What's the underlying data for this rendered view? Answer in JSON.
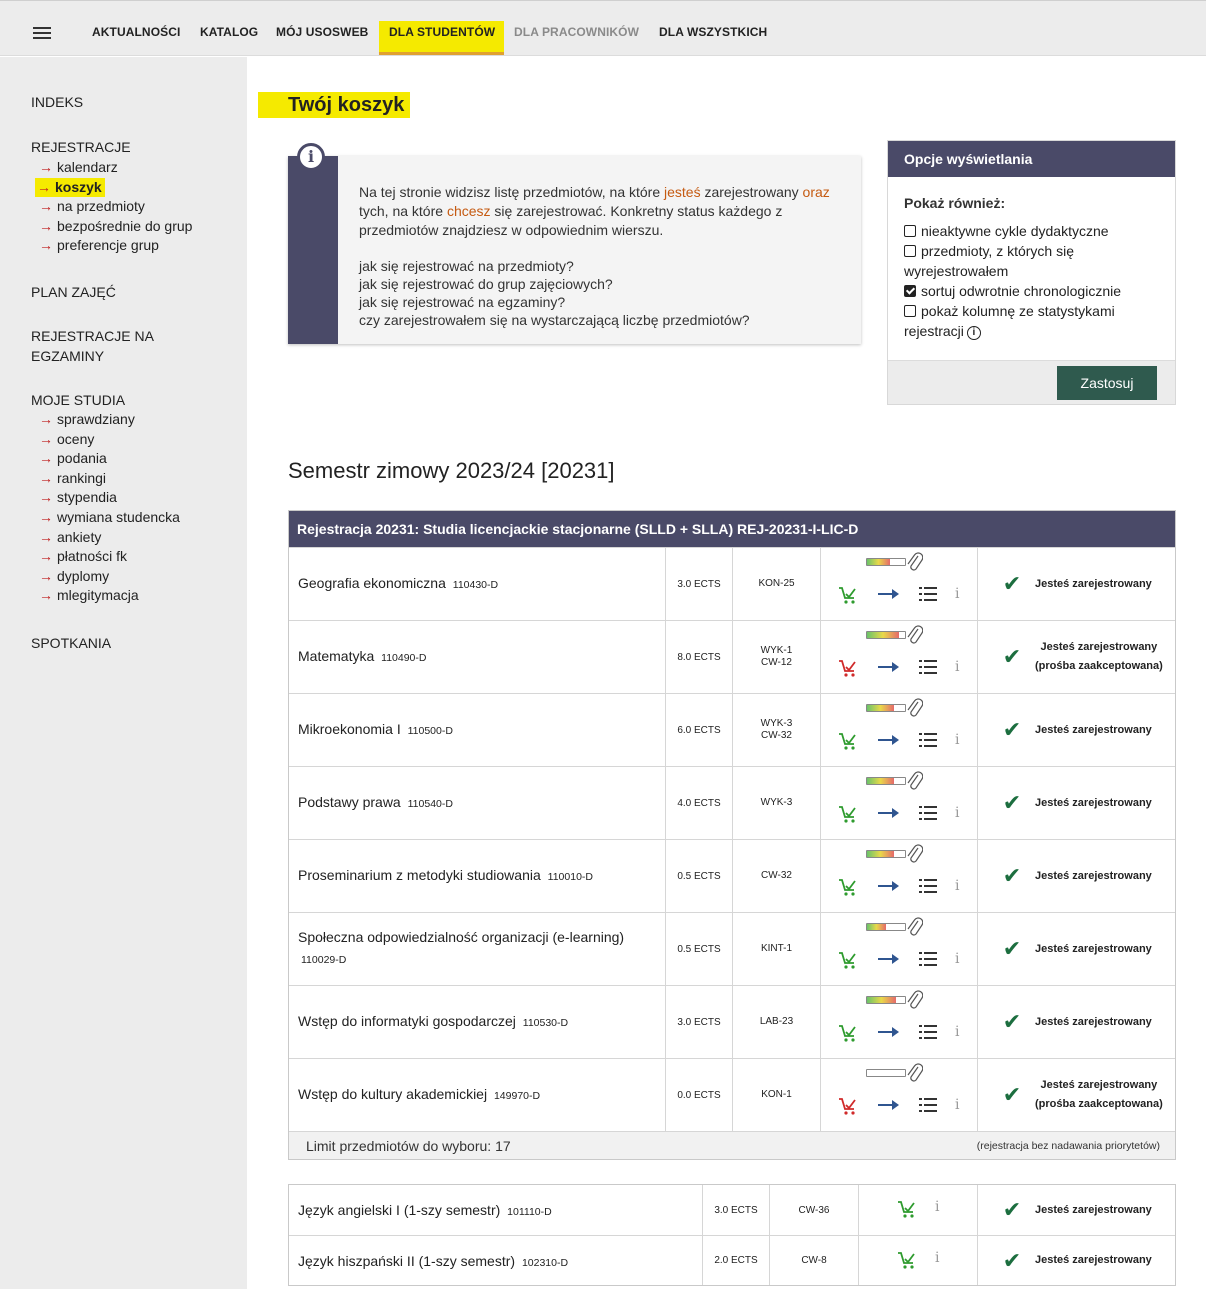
{
  "nav": {
    "items": [
      "AKTUALNOŚCI",
      "KATALOG",
      "MÓJ USOSWEB",
      "DLA STUDENTÓW",
      "DLA PRACOWNIKÓW",
      "DLA WSZYSTKICH"
    ],
    "active": "DLA STUDENTÓW"
  },
  "sidebar": {
    "indeks": "INDEKS",
    "rejestracje": "REJESTRACJE",
    "rej_items": [
      "kalendarz",
      "koszyk",
      "na przedmioty",
      "bezpośrednie do grup",
      "preferencje grup"
    ],
    "plan": "PLAN ZAJĘĆ",
    "rej_egz_1": "REJESTRACJE NA",
    "rej_egz_2": "EGZAMINY",
    "studia": "MOJE STUDIA",
    "studia_items": [
      "sprawdziany",
      "oceny",
      "podania",
      "rankingi",
      "stypendia",
      "wymiana studencka",
      "ankiety",
      "płatności fk",
      "dyplomy",
      "mlegitymacja"
    ],
    "spotkania": "SPOTKANIA"
  },
  "page_title": "Twój koszyk",
  "info": {
    "t1": "Na tej stronie widzisz listę przedmiotów, na które ",
    "t2": "jesteś",
    "t3": " zarejestrowany ",
    "t4": "oraz",
    "t5": " tych, na które ",
    "t6": "chcesz",
    "t7": " się zarejestrować. Konkretny status każdego z przedmiotów znajdziesz w odpowiednim wierszu.",
    "links": [
      "jak się rejestrować na przedmioty?",
      "jak się rejestrować do grup zajęciowych?",
      "jak się rejestrować na egzaminy?",
      "czy zarejestrowałem się na wystarczającą liczbę przedmiotów?"
    ]
  },
  "options": {
    "title": "Opcje wyświetlania",
    "subtitle": "Pokaż również:",
    "items": [
      {
        "label": "nieaktywne cykle dydaktyczne",
        "checked": false
      },
      {
        "label": "przedmioty, z których się wyrejestrowałem",
        "checked": false
      },
      {
        "label": "sortuj odwrotnie chronologicznie",
        "checked": true
      },
      {
        "label": "pokaż kolumnę ze statystykami rejestracji",
        "checked": false
      }
    ],
    "apply": "Zastosuj"
  },
  "semester": "Semestr zimowy 2023/24 [20231]",
  "registration": {
    "header": "Rejestracja 20231: Studia licencjackie stacjonarne (SLLD + SLLA) REJ-20231-I-LIC-D",
    "rows": [
      {
        "name": "Geografia ekonomiczna",
        "code": "110430-D",
        "ects": "3.0 ECTS",
        "groups": "KON-25",
        "fill": 0.6,
        "cart_color": "#2e9b2e",
        "status": "Jesteś zarejestrowany",
        "status2": ""
      },
      {
        "name": "Matematyka",
        "code": "110490-D",
        "ects": "8.0 ECTS",
        "groups": "WYK-1\nCW-12",
        "fill": 0.85,
        "cart_color": "#d02a2a",
        "status": "Jesteś zarejestrowany",
        "status2": "(prośba zaakceptowana)"
      },
      {
        "name": "Mikroekonomia I",
        "code": "110500-D",
        "ects": "6.0 ECTS",
        "groups": "WYK-3\nCW-32",
        "fill": 0.7,
        "cart_color": "#2e9b2e",
        "status": "Jesteś zarejestrowany",
        "status2": ""
      },
      {
        "name": "Podstawy prawa",
        "code": "110540-D",
        "ects": "4.0 ECTS",
        "groups": "WYK-3",
        "fill": 0.7,
        "cart_color": "#2e9b2e",
        "status": "Jesteś zarejestrowany",
        "status2": ""
      },
      {
        "name": "Proseminarium z metodyki studiowania",
        "code": "110010-D",
        "ects": "0.5 ECTS",
        "groups": "CW-32",
        "fill": 0.7,
        "cart_color": "#2e9b2e",
        "status": "Jesteś zarejestrowany",
        "status2": ""
      },
      {
        "name": "Społeczna odpowiedzialność organizacji (e-learning)",
        "code": "110029-D",
        "ects": "0.5 ECTS",
        "groups": "KINT-1",
        "fill": 0.5,
        "cart_color": "#2e9b2e",
        "status": "Jesteś zarejestrowany",
        "status2": ""
      },
      {
        "name": "Wstęp do informatyki gospodarczej",
        "code": "110530-D",
        "ects": "3.0 ECTS",
        "groups": "LAB-23",
        "fill": 0.75,
        "cart_color": "#2e9b2e",
        "status": "Jesteś zarejestrowany",
        "status2": ""
      },
      {
        "name": "Wstęp do kultury akademickiej",
        "code": "149970-D",
        "ects": "0.0 ECTS",
        "groups": "KON-1",
        "fill": 0.0,
        "cart_color": "#d02a2a",
        "status": "Jesteś zarejestrowany",
        "status2": "(prośba zaakceptowana)"
      }
    ],
    "limit": "Limit przedmiotów do wyboru: 17",
    "note": "(rejestracja bez nadawania priorytetów)"
  },
  "languages": [
    {
      "name": "Język angielski I (1-szy semestr)",
      "code": "101110-D",
      "ects": "3.0 ECTS",
      "groups": "CW-36",
      "status": "Jesteś zarejestrowany"
    },
    {
      "name": "Język hiszpański II (1-szy semestr)",
      "code": "102310-D",
      "ects": "2.0 ECTS",
      "groups": "CW-8",
      "status": "Jesteś zarejestrowany"
    }
  ],
  "colors": {
    "accent_yellow": "#f5ea00",
    "header_purple": "#4a4a68",
    "check_green": "#1c6e3f",
    "apply_green": "#2f5a4e",
    "highlight_orange": "#c55a11"
  }
}
